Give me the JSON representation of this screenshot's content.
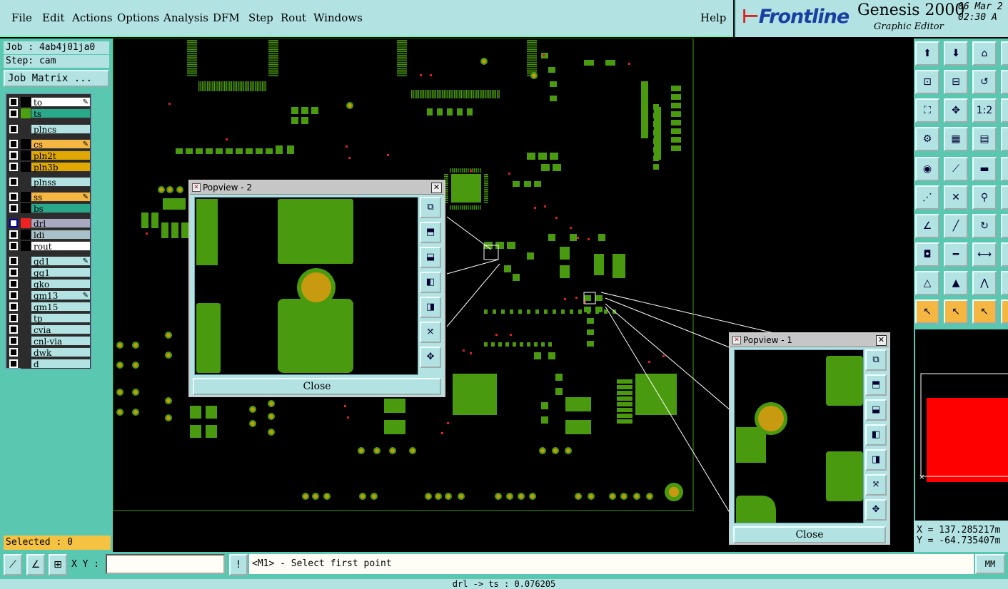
{
  "menu": {
    "items": [
      "File",
      "Edit",
      "Actions",
      "Options",
      "Analysis",
      "DFM",
      "Step",
      "Rout",
      "Windows"
    ],
    "help": "Help"
  },
  "brand": {
    "logo": "Frontline",
    "title": "Genesis 2000",
    "subtitle": "Graphic Editor",
    "date": "06 Mar 2",
    "time": "02:30 A"
  },
  "left_panel": {
    "job": "Job : 4ab4j01ja0",
    "step": "Step: cam",
    "job_matrix": "Job Matrix ...",
    "layers": [
      {
        "name": "to",
        "color": "#ffffff",
        "swatch": "#000000"
      },
      {
        "name": "ts",
        "color": "#2aa88a",
        "swatch": "#4aa010"
      },
      {
        "name": "plncs",
        "color": "#b2e2e2",
        "swatch": ""
      },
      {
        "name": "cs",
        "color": "#f5b642",
        "swatch": "#000000"
      },
      {
        "name": "pln2t",
        "color": "#e0a800",
        "swatch": "#000000"
      },
      {
        "name": "pln3b",
        "color": "#e0a800",
        "swatch": "#000000"
      },
      {
        "name": "plnss",
        "color": "#b2e2e2",
        "swatch": ""
      },
      {
        "name": "ss",
        "color": "#f5b642",
        "swatch": "#000000"
      },
      {
        "name": "bs",
        "color": "#2aa88a",
        "swatch": "#000000"
      },
      {
        "name": "drl",
        "color": "#a8a8c0",
        "swatch": "#ee2222"
      },
      {
        "name": "ldi",
        "color": "#a8c0c8",
        "swatch": "#000000"
      },
      {
        "name": "rout",
        "color": "#ffffff",
        "swatch": "#000000"
      },
      {
        "name": "gd1",
        "color": "#b2e2e2",
        "swatch": ""
      },
      {
        "name": "gg1",
        "color": "#b2e2e2",
        "swatch": ""
      },
      {
        "name": "gko",
        "color": "#b2e2e2",
        "swatch": ""
      },
      {
        "name": "gm13",
        "color": "#b2e2e2",
        "swatch": ""
      },
      {
        "name": "gm15",
        "color": "#b2e2e2",
        "swatch": ""
      },
      {
        "name": "tp",
        "color": "#b2e2e2",
        "swatch": ""
      },
      {
        "name": "cvia",
        "color": "#b2e2e2",
        "swatch": ""
      },
      {
        "name": "cnl-via",
        "color": "#b2e2e2",
        "swatch": ""
      },
      {
        "name": "dwk",
        "color": "#b2e2e2",
        "swatch": ""
      },
      {
        "name": "d",
        "color": "#b2e2e2",
        "swatch": ""
      }
    ],
    "selected": "Selected : 0"
  },
  "popview2": {
    "title": "Popview - 2",
    "close": "Close"
  },
  "popview1": {
    "title": "Popview - 1",
    "close": "Close"
  },
  "coords": {
    "x": "X = 137.285217m",
    "y": "Y = -64.735407m"
  },
  "status": {
    "xy_label": "X Y :",
    "xy_value": "",
    "prompt": "<M1> - Select first point",
    "units": "MM",
    "bottom": "drl -> ts : 0.076205"
  },
  "colors": {
    "pad": "#4a9a10",
    "drill": "#c89a10",
    "panel": "#5ac8b0",
    "button": "#b2e2e2"
  }
}
